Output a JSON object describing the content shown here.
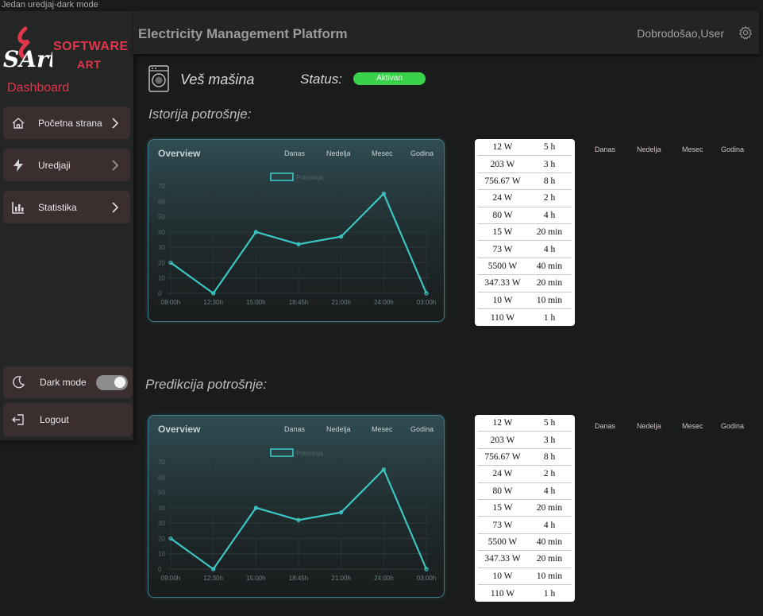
{
  "window": {
    "title": "Jedan uredjaj-dark mode"
  },
  "brand": {
    "line1": "SOFTWARE",
    "line2": "ART",
    "mark_text": "SArt",
    "accent": "#e0354a"
  },
  "sidebar": {
    "heading": "Dashboard",
    "items": [
      {
        "label": "Početna strana",
        "icon": "home-icon"
      },
      {
        "label": "Uredjaji",
        "icon": "bolt-icon"
      },
      {
        "label": "Statistika",
        "icon": "bar-chart-icon"
      }
    ],
    "dark_mode": {
      "label": "Dark mode",
      "icon": "moon-icon",
      "enabled": true
    },
    "logout": {
      "label": "Logout",
      "icon": "logout-icon"
    }
  },
  "header": {
    "title": "Electricity Management Platform",
    "welcome": "Dobrodošao,User",
    "settings_icon": "gear-icon"
  },
  "device": {
    "name": "Veš mašina",
    "icon": "washing-machine-icon",
    "status_label": "Status:",
    "status_value": "Aktivan",
    "status_color": "#3ad24a"
  },
  "history": {
    "title": "Istorija potrošnje:",
    "card": {
      "heading": "Overview",
      "tabs": [
        "Danas",
        "Nedelja",
        "Mesec",
        "Godina"
      ]
    },
    "side_tabs": [
      "Danas",
      "Nedelja",
      "Mesec",
      "Godina"
    ],
    "table": [
      [
        "12 W",
        "5 h"
      ],
      [
        "203 W",
        "3 h"
      ],
      [
        "756.67 W",
        "8 h"
      ],
      [
        "24 W",
        "2 h"
      ],
      [
        "80 W",
        "4 h"
      ],
      [
        "15 W",
        "20 min"
      ],
      [
        "73 W",
        "4 h"
      ],
      [
        "5500 W",
        "40 min"
      ],
      [
        "347.33 W",
        "20 min"
      ],
      [
        "10 W",
        "10 min"
      ],
      [
        "110 W",
        "1 h"
      ]
    ]
  },
  "prediction": {
    "title": "Predikcija potrošnje:",
    "card": {
      "heading": "Overview",
      "tabs": [
        "Danas",
        "Nedelja",
        "Mesec",
        "Godina"
      ]
    },
    "side_tabs": [
      "Danas",
      "Nedelja",
      "Mesec",
      "Godina"
    ],
    "table": [
      [
        "12 W",
        "5 h"
      ],
      [
        "203 W",
        "3 h"
      ],
      [
        "756.67 W",
        "8 h"
      ],
      [
        "24 W",
        "2 h"
      ],
      [
        "80 W",
        "4 h"
      ],
      [
        "15 W",
        "20 min"
      ],
      [
        "73 W",
        "4 h"
      ],
      [
        "5500 W",
        "40 min"
      ],
      [
        "347.33 W",
        "20 min"
      ],
      [
        "10 W",
        "10 min"
      ],
      [
        "110 W",
        "1 h"
      ]
    ]
  },
  "chart_data": [
    {
      "type": "line",
      "x": [
        "09:00h",
        "12:30h",
        "15:00h",
        "18:45h",
        "21:00h",
        "24:00h",
        "03:00h"
      ],
      "series": [
        {
          "name": "Potrošnja",
          "values": [
            20,
            0,
            40,
            32,
            37,
            65,
            0
          ],
          "color": "#3cc6c3"
        }
      ],
      "ylim": [
        0,
        70
      ],
      "yticks": [
        0,
        10,
        20,
        30,
        40,
        50,
        60,
        70
      ],
      "grid": true,
      "legend": "top-center"
    },
    {
      "type": "line",
      "x": [
        "09:00h",
        "12:30h",
        "15:00h",
        "18:45h",
        "21:00h",
        "24:00h",
        "03:00h"
      ],
      "series": [
        {
          "name": "Potrošnja",
          "values": [
            20,
            0,
            40,
            32,
            37,
            65,
            0
          ],
          "color": "#3cc6c3"
        }
      ],
      "ylim": [
        0,
        70
      ],
      "yticks": [
        0,
        10,
        20,
        30,
        40,
        50,
        60,
        70
      ],
      "grid": true,
      "legend": "top-center"
    }
  ]
}
